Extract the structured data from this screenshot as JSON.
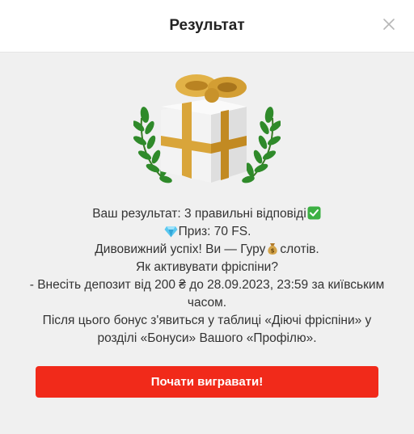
{
  "modal": {
    "title": "Результат",
    "close_icon": "close-icon"
  },
  "result": {
    "line1": "Ваш результат: 3 правильні відповіді",
    "line1_icon": "check-mark-icon",
    "line2_icon": "diamond-icon",
    "line2": "Приз: 70 FS.",
    "line3_start": "Дивовижний успіх! Ви — Гуру",
    "line3_icon": "money-bag-icon",
    "line3_end": "слотів.",
    "line4": "Як активувати фріспіни?",
    "line5": "- Внесіть депозит від 200 ₴ до 28.09.2023, 23:59 за київським часом.",
    "line6": "Після цього бонус з'явиться у таблиці «Діючі фріспіни» у розділі «Бонуси» Вашого «Профілю»."
  },
  "cta": {
    "label": "Почати вигравати!",
    "color": "#f12a1a"
  },
  "illustration": {
    "icon": "gift-with-laurel-icon"
  }
}
